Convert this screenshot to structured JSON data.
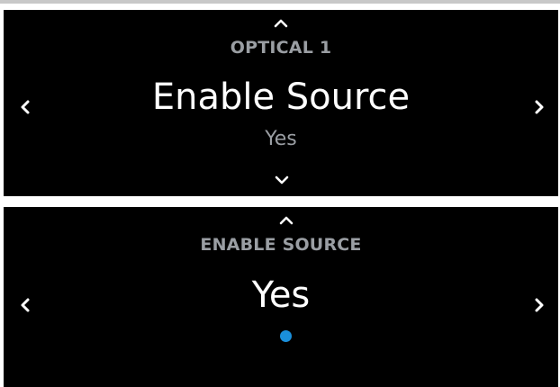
{
  "screen_top": {
    "heading": "OPTICAL 1",
    "title": "Enable Source",
    "value": "Yes",
    "icons": {
      "up": "chevron-up-icon",
      "down": "chevron-down-icon",
      "left": "chevron-left-icon",
      "right": "chevron-right-icon"
    }
  },
  "screen_bottom": {
    "heading": "ENABLE SOURCE",
    "title": "Yes",
    "selection_dot_color": "#1a8fdb",
    "icons": {
      "up": "chevron-up-icon",
      "left": "chevron-left-icon",
      "right": "chevron-right-icon",
      "indicator": "selection-dot-icon"
    }
  },
  "colors": {
    "background": "#000000",
    "heading": "#9a9ea3",
    "title": "#ffffff",
    "value": "#9a9ea3",
    "accent": "#1a8fdb"
  }
}
